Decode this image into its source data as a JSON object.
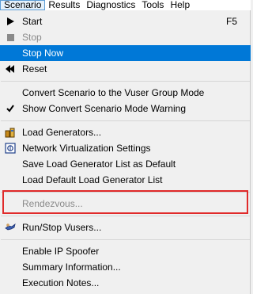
{
  "menubar": {
    "items": [
      {
        "label": "Scenario"
      },
      {
        "label": "Results"
      },
      {
        "label": "Diagnostics"
      },
      {
        "label": "Tools"
      },
      {
        "label": "Help"
      }
    ]
  },
  "menu": {
    "start": {
      "label": "Start",
      "shortcut": "F5"
    },
    "stop": {
      "label": "Stop"
    },
    "stop_now": {
      "label": "Stop Now"
    },
    "reset": {
      "label": "Reset"
    },
    "convert": {
      "label": "Convert Scenario to the Vuser Group Mode"
    },
    "show_warning": {
      "label": "Show Convert Scenario Mode Warning",
      "checked": true
    },
    "load_generators": {
      "label": "Load Generators..."
    },
    "network_virtualization": {
      "label": "Network Virtualization Settings"
    },
    "save_lg_list": {
      "label": "Save Load Generator List as Default"
    },
    "load_lg_list": {
      "label": "Load Default Load Generator List"
    },
    "rendezvous": {
      "label": "Rendezvous..."
    },
    "run_stop_vusers": {
      "label": "Run/Stop Vusers..."
    },
    "ip_spoofer": {
      "label": "Enable IP Spoofer"
    },
    "summary": {
      "label": "Summary Information..."
    },
    "execution_notes": {
      "label": "Execution Notes..."
    }
  },
  "colors": {
    "highlight": "#0078d7",
    "active_menu_border": "#5e9ed6",
    "annotation_box": "#e02a2a"
  }
}
